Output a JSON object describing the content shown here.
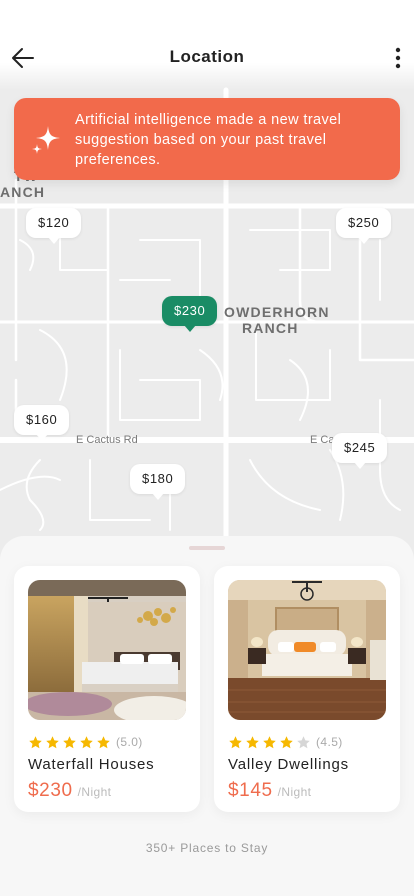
{
  "header": {
    "title": "Location",
    "back_icon": "arrow-left-icon",
    "more_icon": "more-vertical-icon"
  },
  "ai_banner": {
    "icon": "sparkle-icon",
    "text": "Artificial intelligence made a new travel suggestion based on your past travel preferences.",
    "color": "#f26a4b"
  },
  "map": {
    "labels": {
      "left_partial_top": "TW",
      "left_partial_bottom": "ANCH",
      "powderhorn_line1": "OWDERHORN",
      "powderhorn_line2": "RANCH",
      "street_main": "E Cactus Rd",
      "street_right": "E Ca"
    },
    "pins": [
      {
        "label": "$120",
        "active": false
      },
      {
        "label": "$250",
        "active": false
      },
      {
        "label": "$230",
        "active": true
      },
      {
        "label": "$160",
        "active": false
      },
      {
        "label": "$245",
        "active": false
      },
      {
        "label": "$180",
        "active": false
      }
    ],
    "active_pin_color": "#1a8c65"
  },
  "listings": [
    {
      "name": "Waterfall Houses",
      "rating": "(5.0)",
      "stars_filled": 5,
      "price": "$230",
      "per": "/Night"
    },
    {
      "name": "Valley Dwellings",
      "rating": "(4.5)",
      "stars_filled": 4,
      "price": "$145",
      "per": "/Night"
    }
  ],
  "footer": {
    "places_count": "350+ Places to Stay"
  },
  "colors": {
    "accent": "#ef6c4d",
    "star": "#f6b800",
    "star_empty": "#d6d6d6"
  }
}
